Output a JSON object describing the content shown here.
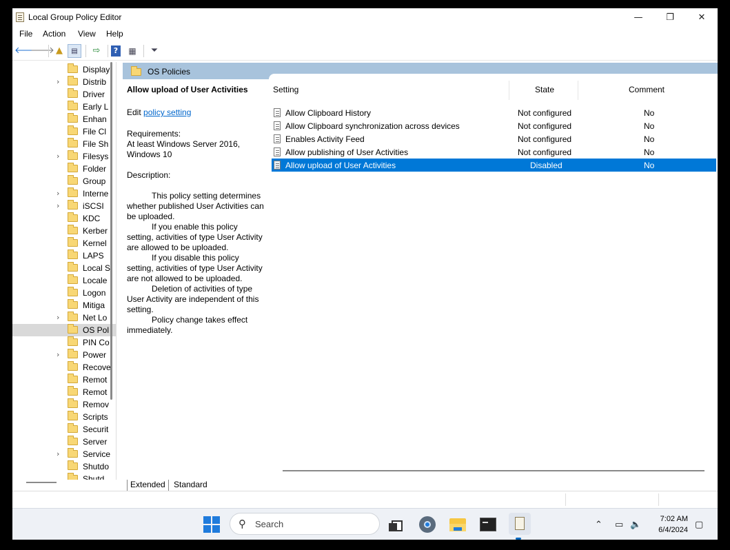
{
  "window": {
    "title": "Local Group Policy Editor",
    "controls": {
      "minimize": "—",
      "maximize": "❐",
      "close": "✕"
    }
  },
  "menu": [
    "File",
    "Action",
    "View",
    "Help"
  ],
  "toolbar": {
    "icons": [
      "back-icon",
      "forward-icon",
      "up-folder-icon",
      "show-hide-tree-icon",
      "export-list-icon",
      "help-icon",
      "properties-icon",
      "filter-icon"
    ]
  },
  "tree": {
    "items": [
      {
        "label": "Display",
        "expandable": false
      },
      {
        "label": "Distrib",
        "expandable": true
      },
      {
        "label": "Driver",
        "expandable": false
      },
      {
        "label": "Early L",
        "expandable": false
      },
      {
        "label": "Enhan",
        "expandable": false
      },
      {
        "label": "File Cl",
        "expandable": false
      },
      {
        "label": "File Sh",
        "expandable": false
      },
      {
        "label": "Filesys",
        "expandable": true
      },
      {
        "label": "Folder",
        "expandable": false
      },
      {
        "label": "Group",
        "expandable": false
      },
      {
        "label": "Interne",
        "expandable": true
      },
      {
        "label": "iSCSI",
        "expandable": true
      },
      {
        "label": "KDC",
        "expandable": false
      },
      {
        "label": "Kerber",
        "expandable": false
      },
      {
        "label": "Kernel",
        "expandable": false
      },
      {
        "label": "LAPS",
        "expandable": false
      },
      {
        "label": "Local S",
        "expandable": false
      },
      {
        "label": "Locale",
        "expandable": false
      },
      {
        "label": "Logon",
        "expandable": false
      },
      {
        "label": "Mitiga",
        "expandable": false
      },
      {
        "label": "Net Lo",
        "expandable": true
      },
      {
        "label": "OS Pol",
        "expandable": false,
        "selected": true
      },
      {
        "label": "PIN Co",
        "expandable": false
      },
      {
        "label": "Power",
        "expandable": true
      },
      {
        "label": "Recove",
        "expandable": false
      },
      {
        "label": "Remot",
        "expandable": false
      },
      {
        "label": "Remot",
        "expandable": false
      },
      {
        "label": "Remov",
        "expandable": false
      },
      {
        "label": "Scripts",
        "expandable": false
      },
      {
        "label": "Securit",
        "expandable": false
      },
      {
        "label": "Server",
        "expandable": false
      },
      {
        "label": "Service",
        "expandable": true
      },
      {
        "label": "Shutdo",
        "expandable": false
      },
      {
        "label": "Shutd",
        "expandable": false
      }
    ]
  },
  "main": {
    "header": "OS Policies",
    "description": {
      "title": "Allow upload of User Activities",
      "edit_prefix": "Edit",
      "edit_link": "policy setting",
      "requirements_label": "Requirements:",
      "requirements": "At least Windows Server 2016, Windows 10",
      "description_label": "Description:",
      "paragraphs": [
        "This policy setting determines whether published User Activities can be uploaded.",
        "If you enable this policy setting, activities of type User Activity are allowed to be uploaded.",
        "If you disable this policy setting, activities of type User Activity are not allowed to be uploaded.",
        "Deletion of activities of type User Activity are independent of this setting.",
        "Policy change takes effect immediately."
      ]
    },
    "columns": [
      "Setting",
      "State",
      "Comment"
    ],
    "rows": [
      {
        "setting": "Allow Clipboard History",
        "state": "Not configured",
        "comment": "No"
      },
      {
        "setting": "Allow Clipboard synchronization across devices",
        "state": "Not configured",
        "comment": "No"
      },
      {
        "setting": "Enables Activity Feed",
        "state": "Not configured",
        "comment": "No"
      },
      {
        "setting": "Allow publishing of User Activities",
        "state": "Not configured",
        "comment": "No"
      },
      {
        "setting": "Allow upload of User Activities",
        "state": "Disabled",
        "comment": "No",
        "selected": true
      }
    ],
    "tabs": [
      "Extended",
      "Standard"
    ]
  },
  "taskbar": {
    "search_placeholder": "Search",
    "apps": [
      "task-view-icon",
      "settings-icon",
      "file-explorer-icon",
      "terminal-icon",
      "group-policy-icon"
    ],
    "tray_icons": [
      "chevron-up-icon",
      "network-icon",
      "volume-icon"
    ],
    "time": "7:02 AM",
    "date": "6/4/2024"
  },
  "colors": {
    "selection": "#0078d7",
    "header": "#a8c3dc",
    "accent": "#0067c0"
  }
}
